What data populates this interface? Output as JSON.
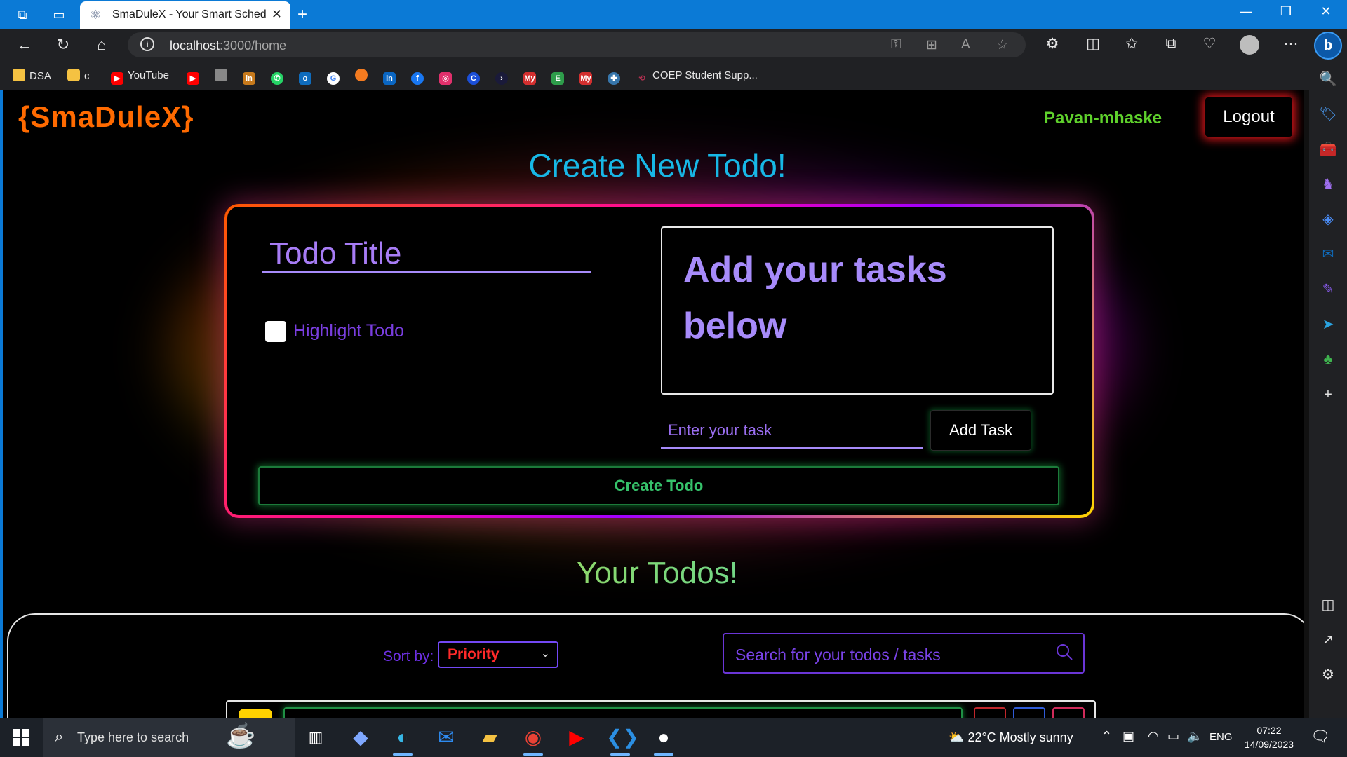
{
  "browser": {
    "tab_title": "SmaDuleX - Your Smart Scheduli",
    "url_host": "localhost",
    "url_path": ":3000/home"
  },
  "bookmarks": [
    {
      "label": "DSA",
      "icon": "folder-icon",
      "color": "#f5c242"
    },
    {
      "label": "c",
      "icon": "folder-icon",
      "color": "#f5c242"
    },
    {
      "label": "YouTube",
      "icon": "youtube-icon",
      "color": "#ff0000"
    },
    {
      "label": "COEP Student Supp...",
      "icon": "coep-icon",
      "color": "#b03050"
    }
  ],
  "app": {
    "brand": "{SmaDuleX}",
    "username": "Pavan-mhaske",
    "logout_label": "Logout"
  },
  "create": {
    "heading": "Create New Todo!",
    "title_placeholder": "Todo Title",
    "highlight_label": "Highlight Todo",
    "tasks_placeholder": "Add your tasks below",
    "task_input_placeholder": "Enter your task",
    "add_task_label": "Add Task",
    "create_label": "Create Todo"
  },
  "todos": {
    "heading": "Your Todos!",
    "sort_label": "Sort by:",
    "sort_value": "Priority",
    "search_placeholder": "Search for your todos / tasks"
  },
  "taskbar": {
    "search_placeholder": "Type here to search",
    "weather": "22°C  Mostly sunny",
    "language": "ENG",
    "time": "07:22",
    "date": "14/09/2023"
  },
  "colors": {
    "brand": "#ff6a00",
    "username": "#5fd12c",
    "create_heading": "#17b8e6",
    "accent_purple": "#a78bfa",
    "create_button": "#36c26b",
    "sort_value": "#ff2a2a"
  }
}
